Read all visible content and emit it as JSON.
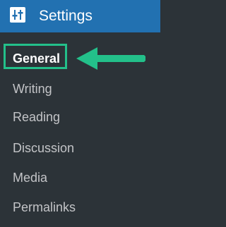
{
  "header": {
    "title": "Settings",
    "icon": "sliders-icon"
  },
  "submenu": {
    "items": [
      {
        "label": "General",
        "current": true
      },
      {
        "label": "Writing",
        "current": false
      },
      {
        "label": "Reading",
        "current": false
      },
      {
        "label": "Discussion",
        "current": false
      },
      {
        "label": "Media",
        "current": false
      },
      {
        "label": "Permalinks",
        "current": false
      }
    ]
  },
  "annotation": {
    "color": "#23c08a",
    "icon": "arrow-left-icon"
  },
  "colors": {
    "header_bg": "#2271b1",
    "menu_bg": "#2c3338",
    "item_text": "#c3c4c7",
    "current_text": "#ffffff"
  }
}
